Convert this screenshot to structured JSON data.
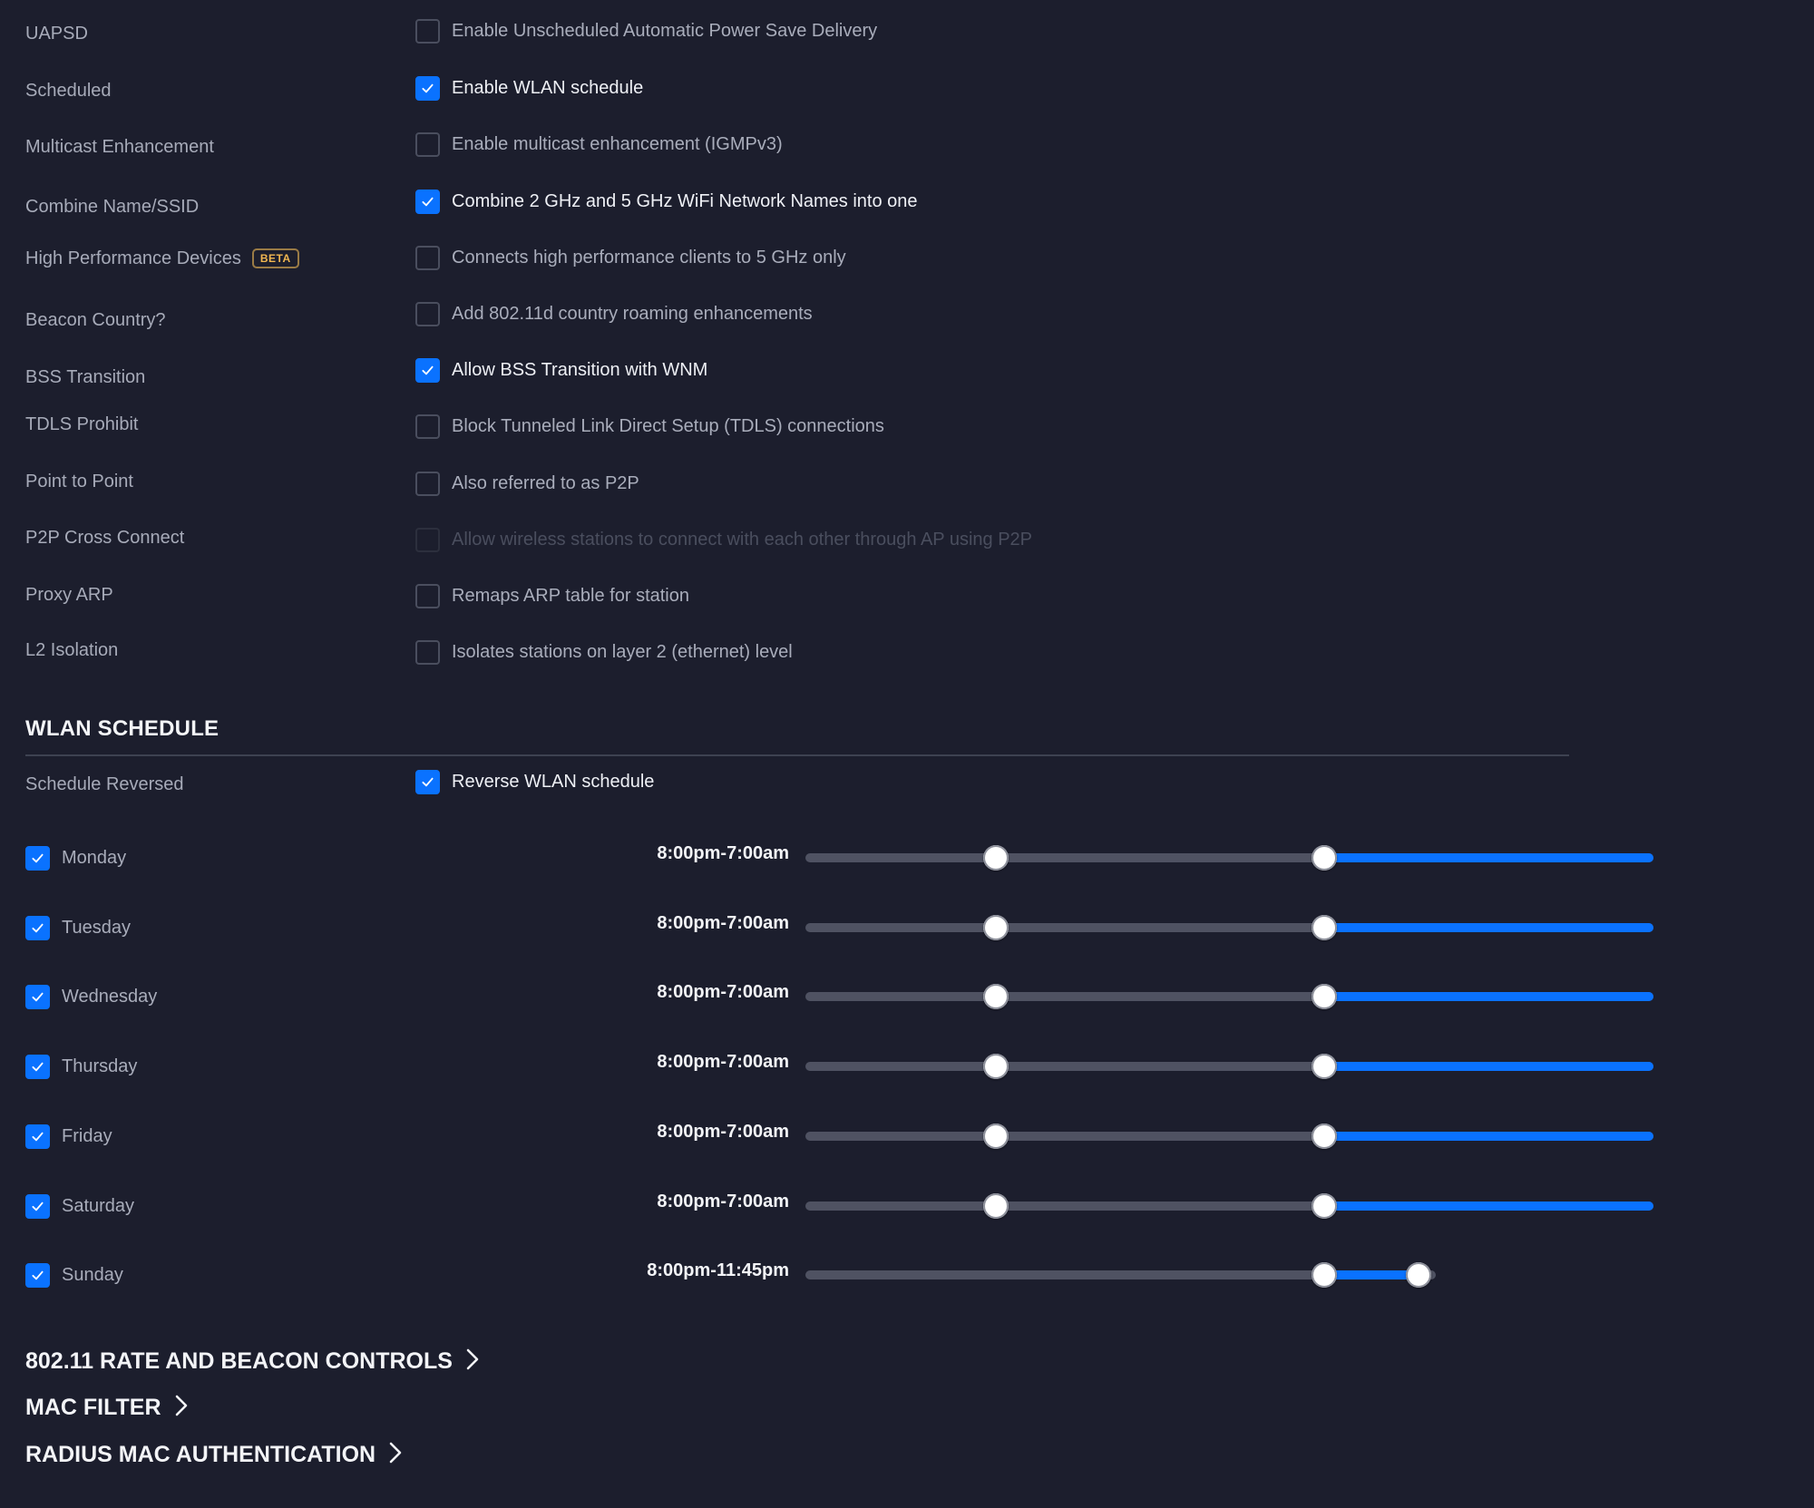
{
  "options": [
    {
      "label": "UAPSD",
      "text": "Enable Unscheduled Automatic Power Save Delivery",
      "checked": false,
      "disabled": false
    },
    {
      "label": "Scheduled",
      "text": "Enable WLAN schedule",
      "checked": true,
      "disabled": false
    },
    {
      "label": "Multicast Enhancement",
      "text": "Enable multicast enhancement (IGMPv3)",
      "checked": false,
      "disabled": false
    },
    {
      "label": "Combine Name/SSID",
      "text": "Combine 2 GHz and 5 GHz WiFi Network Names into one",
      "checked": true,
      "disabled": false
    },
    {
      "label": "High Performance Devices",
      "badge": "BETA",
      "text": "Connects high performance clients to 5 GHz only",
      "checked": false,
      "disabled": false
    },
    {
      "label": "Beacon Country?",
      "text": "Add 802.11d country roaming enhancements",
      "checked": false,
      "disabled": false
    },
    {
      "label": "BSS Transition",
      "text": "Allow BSS Transition with WNM",
      "checked": true,
      "disabled": false
    },
    {
      "label": "TDLS Prohibit",
      "text": "Block Tunneled Link Direct Setup (TDLS) connections",
      "checked": false,
      "disabled": false
    },
    {
      "label": "Point to Point",
      "text": "Also referred to as P2P",
      "checked": false,
      "disabled": false
    },
    {
      "label": "P2P Cross Connect",
      "text": "Allow wireless stations to connect with each other through AP using P2P",
      "checked": false,
      "disabled": true
    },
    {
      "label": "Proxy ARP",
      "text": "Remaps ARP table for station",
      "checked": false,
      "disabled": false
    },
    {
      "label": "L2 Isolation",
      "text": "Isolates stations on layer 2 (ethernet) level",
      "checked": false,
      "disabled": false
    }
  ],
  "wlan_schedule": {
    "title": "WLAN SCHEDULE",
    "reversed": {
      "label": "Schedule Reversed",
      "text": "Reverse WLAN schedule",
      "checked": true
    },
    "days": [
      {
        "name": "Monday",
        "enabled": true,
        "range_text": "8:00pm-7:00am",
        "start_hour": 7.0,
        "end_hour": 20.0,
        "wraps": true
      },
      {
        "name": "Tuesday",
        "enabled": true,
        "range_text": "8:00pm-7:00am",
        "start_hour": 7.0,
        "end_hour": 20.0,
        "wraps": true
      },
      {
        "name": "Wednesday",
        "enabled": true,
        "range_text": "8:00pm-7:00am",
        "start_hour": 7.0,
        "end_hour": 20.0,
        "wraps": true
      },
      {
        "name": "Thursday",
        "enabled": true,
        "range_text": "8:00pm-7:00am",
        "start_hour": 7.0,
        "end_hour": 20.0,
        "wraps": true
      },
      {
        "name": "Friday",
        "enabled": true,
        "range_text": "8:00pm-7:00am",
        "start_hour": 7.0,
        "end_hour": 20.0,
        "wraps": true
      },
      {
        "name": "Saturday",
        "enabled": true,
        "range_text": "8:00pm-7:00am",
        "start_hour": 7.0,
        "end_hour": 20.0,
        "wraps": true
      },
      {
        "name": "Sunday",
        "enabled": true,
        "range_text": "8:00pm-11:45pm",
        "start_hour": 20.0,
        "end_hour": 23.75,
        "wraps": false
      }
    ]
  },
  "collapsibles": [
    {
      "label": "802.11 RATE AND BEACON CONTROLS",
      "icon": "chevron-right-icon"
    },
    {
      "label": "MAC FILTER",
      "icon": "chevron-right-icon"
    },
    {
      "label": "RADIUS MAC AUTHENTICATION",
      "icon": "chevron-right-icon"
    }
  ],
  "colors": {
    "accent": "#0a72ff",
    "background": "#1c1e2d",
    "badge": "#f0b650"
  }
}
